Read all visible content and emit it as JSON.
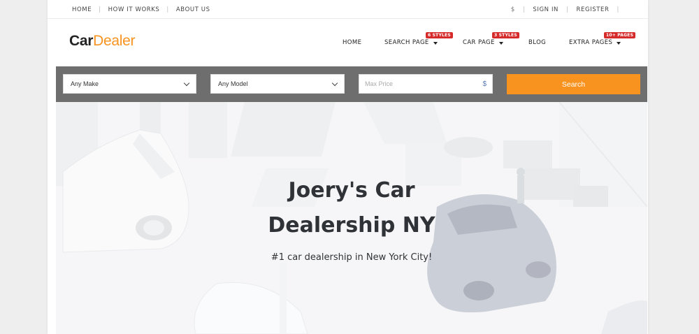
{
  "topbar": {
    "left_links": [
      "HOME",
      "HOW IT WORKS",
      "ABOUT US"
    ],
    "currency": "$",
    "sign_in": "SIGN IN",
    "register": "REGISTER"
  },
  "header": {
    "logo_car": "Car",
    "logo_dealer": "Dealer",
    "nav": {
      "home": "HOME",
      "search_page": "SEARCH PAGE",
      "search_badge": "6 STYLES",
      "car_page": "CAR PAGE",
      "car_badge": "3 STYLES",
      "blog": "BLOG",
      "extra_pages": "EXTRA PAGES",
      "extra_badge": "10+ PAGES"
    }
  },
  "search": {
    "make_selected": "Any Make",
    "model_selected": "Any Model",
    "price_placeholder": "Max Price",
    "currency_symbol": "$",
    "button_label": "Search"
  },
  "hero": {
    "title_line1": "Joery's Car",
    "title_line2": "Dealership NY",
    "subtitle": "#1 car dealership in New York City!"
  },
  "colors": {
    "accent": "#f7931e",
    "badge": "#d62b2b",
    "search_bar_bg": "#6e6e6e",
    "text_dark": "#2f3236"
  }
}
